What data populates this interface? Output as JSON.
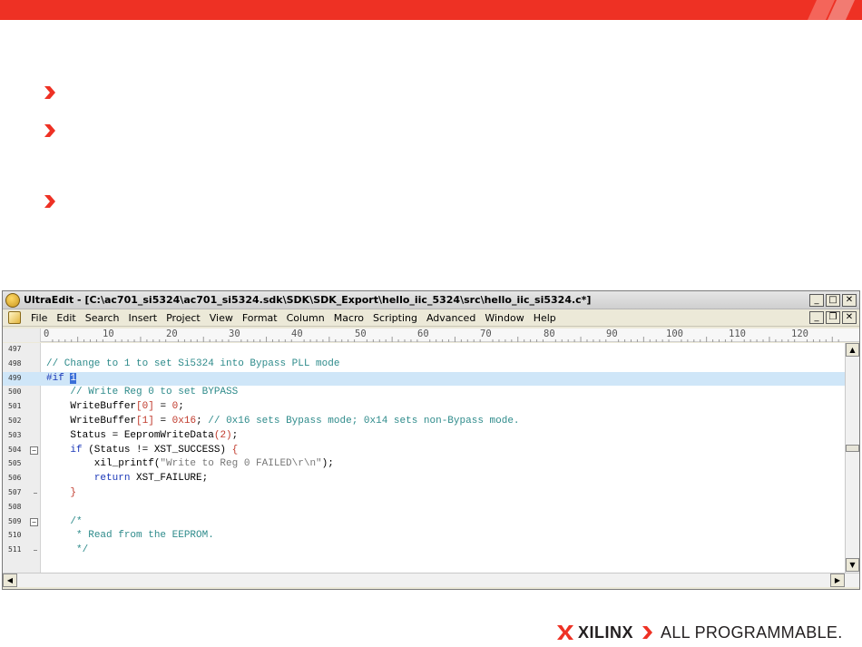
{
  "colors": {
    "brand": "#ee3124",
    "comment": "#2e8b8b",
    "keyword": "#1a37b8",
    "number": "#c0392b",
    "current_line": "#cfe6f8"
  },
  "window": {
    "title": "UltraEdit - [C:\\ac701_si5324\\ac701_si5324.sdk\\SDK\\SDK_Export\\hello_iic_5324\\src\\hello_iic_si5324.c*]",
    "menu": [
      "File",
      "Edit",
      "Search",
      "Insert",
      "Project",
      "View",
      "Format",
      "Column",
      "Macro",
      "Scripting",
      "Advanced",
      "Window",
      "Help"
    ]
  },
  "ruler": [
    "0",
    "10",
    "20",
    "30",
    "40",
    "50",
    "60",
    "70",
    "80",
    "90",
    "100",
    "110",
    "120"
  ],
  "editor": {
    "line_numbers": [
      "497",
      "498",
      "499",
      "500",
      "501",
      "502",
      "503",
      "504",
      "505",
      "506",
      "507",
      "508",
      "509",
      "510",
      "511"
    ],
    "current_line": "499"
  },
  "footer": {
    "brand": "XILINX",
    "tagline": "ALL PROGRAMMABLE."
  }
}
